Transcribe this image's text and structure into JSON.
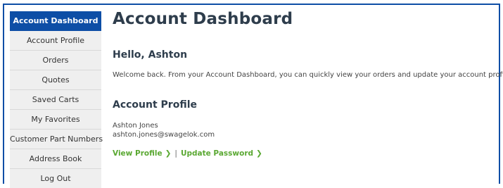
{
  "sidebar": {
    "items": [
      {
        "label": "Account Dashboard",
        "active": true
      },
      {
        "label": "Account Profile"
      },
      {
        "label": "Orders"
      },
      {
        "label": "Quotes"
      },
      {
        "label": "Saved Carts"
      },
      {
        "label": "My Favorites"
      },
      {
        "label": "Customer Part Numbers"
      },
      {
        "label": "Address Book"
      },
      {
        "label": "Log Out"
      }
    ]
  },
  "main": {
    "title": "Account Dashboard",
    "greeting": "Hello, Ashton",
    "welcome": "Welcome back. From your Account Dashboard, you can quickly view your orders and update your account profile.",
    "profile": {
      "heading": "Account Profile",
      "name": "Ashton Jones",
      "email": "ashton.jones@swagelok.com",
      "view_profile": "View Profile",
      "separator": "|",
      "update_password": "Update Password"
    }
  },
  "colors": {
    "brand_blue": "#0d4ea6",
    "link_green": "#5aa832",
    "heading": "#2e3d4c"
  },
  "icons": {
    "link_chevron": "chevron-right-icon"
  }
}
